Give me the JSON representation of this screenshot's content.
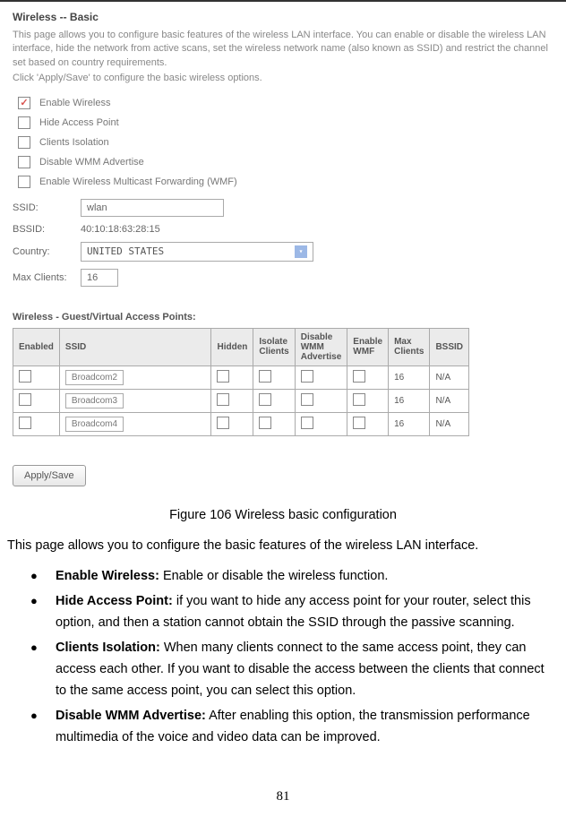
{
  "screenshot": {
    "title": "Wireless -- Basic",
    "desc1": "This page allows you to configure basic features of the wireless LAN interface. You can enable or disable the wireless LAN interface, hide the network from active scans, set the wireless network name (also known as SSID) and restrict the channel set based on country requirements.",
    "desc2": "Click 'Apply/Save' to configure the basic wireless options.",
    "checkboxes": [
      {
        "label": "Enable Wireless",
        "checked": true
      },
      {
        "label": "Hide Access Point",
        "checked": false
      },
      {
        "label": "Clients Isolation",
        "checked": false
      },
      {
        "label": "Disable WMM Advertise",
        "checked": false
      },
      {
        "label": "Enable Wireless Multicast Forwarding (WMF)",
        "checked": false
      }
    ],
    "ssid_label": "SSID:",
    "ssid_value": "wlan",
    "bssid_label": "BSSID:",
    "bssid_value": "40:10:18:63:28:15",
    "country_label": "Country:",
    "country_value": "UNITED STATES",
    "max_label": "Max Clients:",
    "max_value": "16",
    "vap_title": "Wireless - Guest/Virtual Access Points:",
    "vap_headers": [
      "Enabled",
      "SSID",
      "Hidden",
      "Isolate Clients",
      "Disable WMM Advertise",
      "Enable WMF",
      "Max Clients",
      "BSSID"
    ],
    "vap_rows": [
      {
        "ssid": "Broadcom2",
        "max": "16",
        "bssid": "N/A"
      },
      {
        "ssid": "Broadcom3",
        "max": "16",
        "bssid": "N/A"
      },
      {
        "ssid": "Broadcom4",
        "max": "16",
        "bssid": "N/A"
      }
    ],
    "apply_label": "Apply/Save"
  },
  "caption": "Figure 106 Wireless basic configuration",
  "intro": "This page allows you to configure the basic features of the wireless LAN interface.",
  "bullets": [
    {
      "title": "Enable Wireless:",
      "body": " Enable or disable the wireless function."
    },
    {
      "title": "Hide Access Point:",
      "body": " if you want to hide any access point for your router, select this option, and then a station cannot obtain the SSID through the passive scanning."
    },
    {
      "title": "Clients Isolation:",
      "body": " When many clients connect to the same access point, they can access each other. If you want to disable the access between the clients that connect to the same access point, you can select this option."
    },
    {
      "title": "Disable WMM Advertise:",
      "body": " After enabling this option, the transmission performance multimedia of the voice and video data can be improved."
    }
  ],
  "page_number": "81"
}
